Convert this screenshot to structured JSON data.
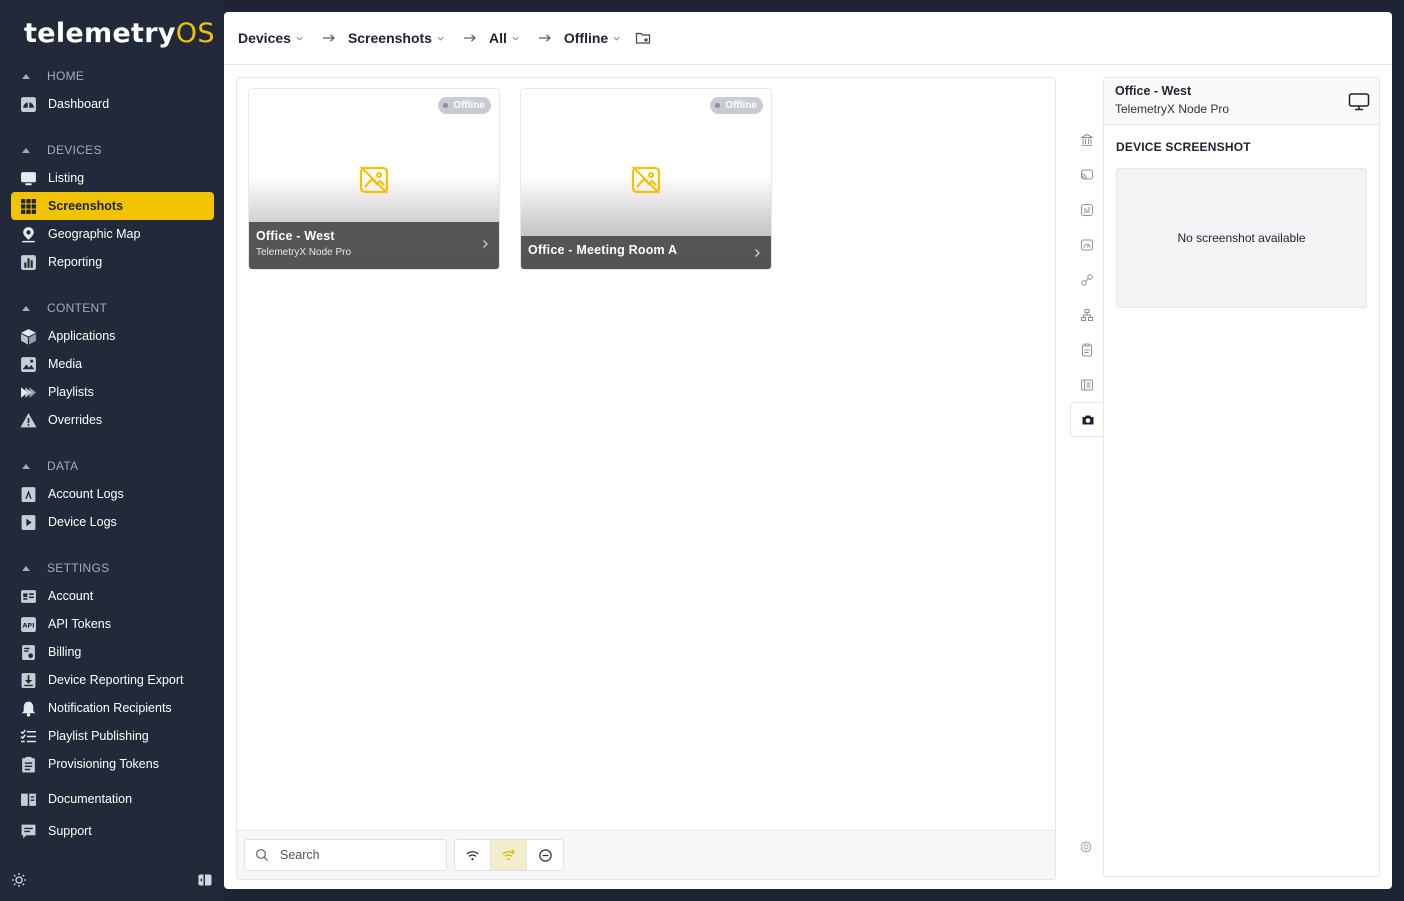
{
  "app": {
    "logo_part1": "telemetry",
    "logo_part2": "OS"
  },
  "sidebar": {
    "sections": {
      "home": "HOME",
      "devices": "DEVICES",
      "content": "CONTENT",
      "data": "DATA",
      "settings": "SETTINGS"
    },
    "items": {
      "dashboard": "Dashboard",
      "listing": "Listing",
      "screenshots": "Screenshots",
      "geographic_map": "Geographic Map",
      "reporting": "Reporting",
      "applications": "Applications",
      "media": "Media",
      "playlists": "Playlists",
      "overrides": "Overrides",
      "account_logs": "Account Logs",
      "device_logs": "Device Logs",
      "account": "Account",
      "api_tokens": "API Tokens",
      "billing": "Billing",
      "device_reporting_export": "Device Reporting Export",
      "notification_recipients": "Notification Recipients",
      "playlist_publishing": "Playlist Publishing",
      "provisioning_tokens": "Provisioning Tokens",
      "documentation": "Documentation",
      "support": "Support"
    },
    "active_item": "screenshots",
    "accent_color": "#f2c300"
  },
  "breadcrumb": [
    {
      "label": "Devices"
    },
    {
      "label": "Screenshots"
    },
    {
      "label": "All"
    },
    {
      "label": "Offline"
    }
  ],
  "cards": [
    {
      "badge": "Offline",
      "name": "Office - West",
      "model": "TelemetryX Node Pro"
    },
    {
      "badge": "Offline",
      "name": "Office - Meeting Room A",
      "model": ""
    }
  ],
  "bottom_bar": {
    "search_placeholder": "Search",
    "filters": [
      "online-filter",
      "offline-filter",
      "disabled-filter"
    ],
    "active_filter": "offline-filter"
  },
  "detail": {
    "device_name": "Office - West",
    "device_model": "TelemetryX Node Pro",
    "section_title": "DEVICE SCREENSHOT",
    "empty_text": "No screenshot available"
  },
  "rail": {
    "icons": [
      "building-icon",
      "cast-icon",
      "info-icon",
      "gauge-icon",
      "link-icon",
      "hierarchy-icon",
      "clipboard-icon",
      "list-icon",
      "camera-icon"
    ],
    "active": "camera-icon"
  }
}
